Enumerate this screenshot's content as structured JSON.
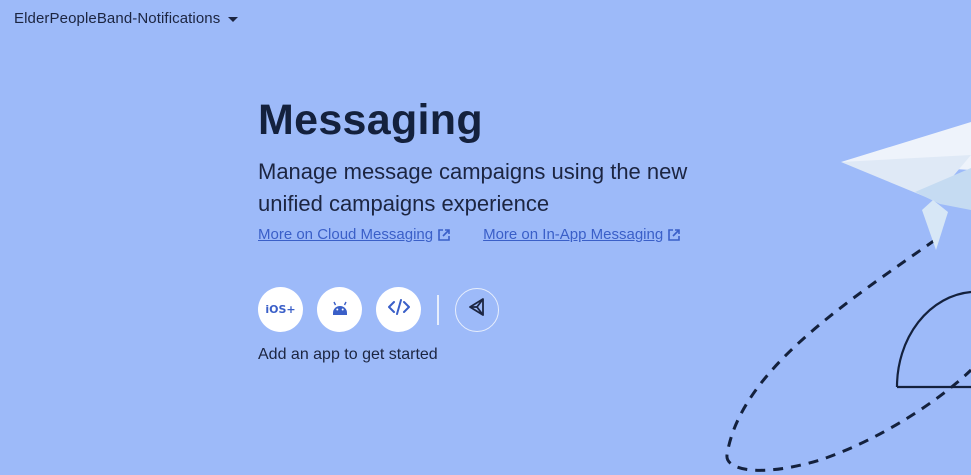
{
  "project": {
    "name": "ElderPeopleBand-Notifications"
  },
  "hero": {
    "title": "Messaging",
    "subtitle": "Manage message campaigns using the new unified campaigns experience",
    "links": [
      {
        "label": "More on Cloud Messaging"
      },
      {
        "label": "More on In-App Messaging"
      }
    ]
  },
  "platforms": {
    "ios_label": "iOS+",
    "items": [
      "ios",
      "android",
      "web",
      "unity"
    ],
    "hint": "Add an app to get started"
  },
  "colors": {
    "background": "#9dbaf9",
    "accent": "#3a5fc8",
    "title": "#14213d"
  },
  "icons": [
    "chevron-down-icon",
    "external-link-icon",
    "android-icon",
    "code-icon",
    "unity-icon",
    "paper-plane-illustration"
  ]
}
